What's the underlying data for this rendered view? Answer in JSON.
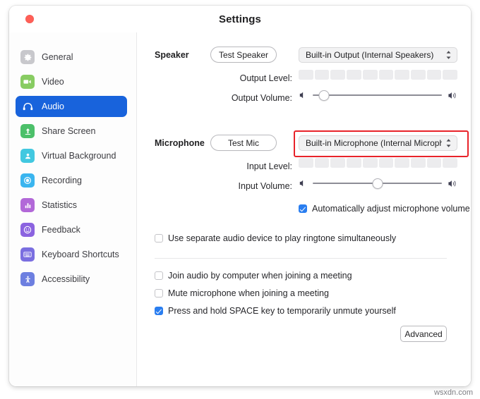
{
  "window": {
    "title": "Settings",
    "close_button": "close"
  },
  "sidebar": {
    "items": [
      {
        "label": "General",
        "icon": "gear-icon",
        "color": "#c8c8cc",
        "active": false
      },
      {
        "label": "Video",
        "icon": "video-camera-icon",
        "color": "#88cc62",
        "active": false
      },
      {
        "label": "Audio",
        "icon": "headphones-icon",
        "color": "#1863dc",
        "active": true
      },
      {
        "label": "Share Screen",
        "icon": "share-screen-icon",
        "color": "#4cc06a",
        "active": false
      },
      {
        "label": "Virtual Background",
        "icon": "virtual-background-icon",
        "color": "#42c8e0",
        "active": false
      },
      {
        "label": "Recording",
        "icon": "record-icon",
        "color": "#3ab5ef",
        "active": false
      },
      {
        "label": "Statistics",
        "icon": "bar-chart-icon",
        "color": "#b268d8",
        "active": false
      },
      {
        "label": "Feedback",
        "icon": "smiley-face-icon",
        "color": "#8b63e0",
        "active": false
      },
      {
        "label": "Keyboard Shortcuts",
        "icon": "keyboard-icon",
        "color": "#7a6ee0",
        "active": false
      },
      {
        "label": "Accessibility",
        "icon": "accessibility-icon",
        "color": "#6d7fe0",
        "active": false
      }
    ]
  },
  "speaker": {
    "section_label": "Speaker",
    "test_button": "Test Speaker",
    "device": "Built-in Output (Internal Speakers)",
    "output_level_label": "Output Level:",
    "output_level_segments": 10,
    "output_level_filled": 0,
    "output_volume_label": "Output Volume:",
    "output_volume_percent": 9
  },
  "microphone": {
    "section_label": "Microphone",
    "test_button": "Test Mic",
    "device": "Built-in Microphone (Internal Microphon…",
    "highlighted": true,
    "highlight_color": "#e8232a",
    "input_level_label": "Input Level:",
    "input_level_segments": 10,
    "input_level_filled": 0,
    "input_volume_label": "Input Volume:",
    "input_volume_percent": 50,
    "auto_adjust": {
      "label": "Automatically adjust microphone volume",
      "checked": true
    }
  },
  "options": {
    "separate_ringtone_device": {
      "label": "Use separate audio device to play ringtone simultaneously",
      "checked": false
    },
    "join_audio_by_computer": {
      "label": "Join audio by computer when joining a meeting",
      "checked": false
    },
    "mute_on_join": {
      "label": "Mute microphone when joining a meeting",
      "checked": false
    },
    "push_to_talk": {
      "label": "Press and hold SPACE key to temporarily unmute yourself",
      "checked": true
    }
  },
  "advanced_button": "Advanced",
  "watermark": "wsxdn.com",
  "colors": {
    "accent": "#1863dc",
    "checkbox_blue": "#2a7ef0",
    "highlight_red": "#e8232a",
    "close_red": "#ff5f57"
  }
}
